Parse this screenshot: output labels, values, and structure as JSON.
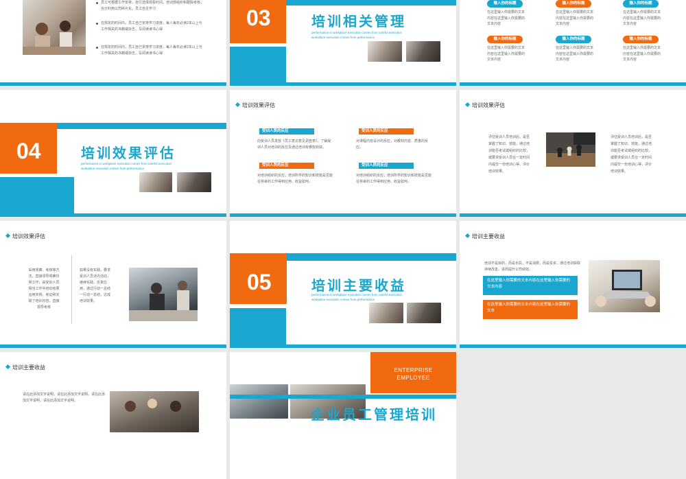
{
  "grid_title": "slide-overview",
  "colors": {
    "accent_blue": "#1aa7cf",
    "accent_orange": "#f26a10"
  },
  "slide1": {
    "bullets": [
      "员工可根据工作安排，自行选择观看时间，培训部组织和跟踪考核；充分利用公司碎片化，员工自主学习",
      "在规定的时间内，员工自己安排学习进度，每人每年必读2本以上与工作相关的书籍或杂志，写阅读读书心得",
      "在规定的时间内，员工自己安排学习进度，每人每年必读2本以上与工作相关的书籍或杂志，写阅读读书心得"
    ]
  },
  "slide2": {
    "number": "03",
    "title": "培训相关管理",
    "sub1": "performance in workplace execution comes from careful execution",
    "sub2": "workplace execution comes from performance"
  },
  "slide3": {
    "pills": [
      "输入你的标题",
      "输入你的标题",
      "输入你的标题",
      "输入你的标题",
      "输入你的标题",
      "输入你的标题"
    ],
    "texts": [
      "在这里输入你需要的文本内容在这里输入你需要的文本内容",
      "在这里输入你需要的文本内容在这里输入你需要的文本内容",
      "在这里输入你需要的文本内容在这里输入你需要的文本内容",
      "在这里输入你需要的文本内容在这里输入你需要的文本内容",
      "在这里输入你需要的文本内容在这里输入你需要的文本内容",
      "在这里输入你需要的文本内容在这里输入你需要的文本内容"
    ]
  },
  "slide4": {
    "number": "04",
    "title": "培训效果评估",
    "sub1": "performance in workplace execution comes from careful execution",
    "sub2": "workplace execution comes from performance"
  },
  "slide5": {
    "title": "培训效果评估",
    "tags": [
      "受训人员的反应",
      "受训人员的反应",
      "受训人员的反应",
      "受训人员的反应"
    ],
    "texts": [
      "向受训人员发放《员工意识意见调查表》，了解受训人员对培训的反应及通过培训有哪些收获。",
      "对课程内容设计的反应，对教材内容、质量的反应。",
      "对培训组织的反应；培训所学的知识和技能是否能在将来的工作得到应用，收益如何。",
      "对培训组织的反应；培训所学的知识和技能是否能在将来的工作得到应用，收益如何。"
    ]
  },
  "slide6": {
    "title": "培训效果评估",
    "left": "评估受训人员培训后，是否掌握了知识、技能，通过培训能否考试或组织的比较，或要求受训人员在一定时间内提交一份培训心得，评价培训效果。",
    "right": "评估受训人员培训后，是否掌握了知识、技能，通过培训能否考试或组织的比较，或要求受训人员在一定时间内提交一份培训心得，评价培训效果。"
  },
  "slide7": {
    "title": "培训效果评估",
    "left": "采用观察、考核等方法，直接领导观察日常工作，由受训人员相当工作中培训结果运用实例，考证和实践了培训内容，直接领导考核",
    "right": "如果没有实践，要求受训人员法内活动，继续实践，反复应用，通过行动一总结一行动一总结，达成培训效果。"
  },
  "slide8": {
    "number": "05",
    "title": "培训主要收益",
    "sub1": "performance in workplace execution comes from careful execution",
    "sub2": "workplace execution comes from performance"
  },
  "slide9": {
    "title": "培训主要收益",
    "intro": "培训不是目的，而是手段，不是消费，而是投资，通过培训获取持续改善，进而提升公司绩效。",
    "box_blue": "在这里输入你需要的文本内容在这里输入你需要的文本内容",
    "box_orange": "在这里输入你需要的文本内容在这里输入你需要的文本"
  },
  "slide10": {
    "title": "培训主要收益",
    "text": "请在此添加文字说明，请在此添加文字说明。请在此添加文字说明，请在此添加文字说明。"
  },
  "slide11": {
    "enterprise": "ENTERPRISE",
    "employee": "EMPLOYEE",
    "title": "企业员工管理培训"
  }
}
